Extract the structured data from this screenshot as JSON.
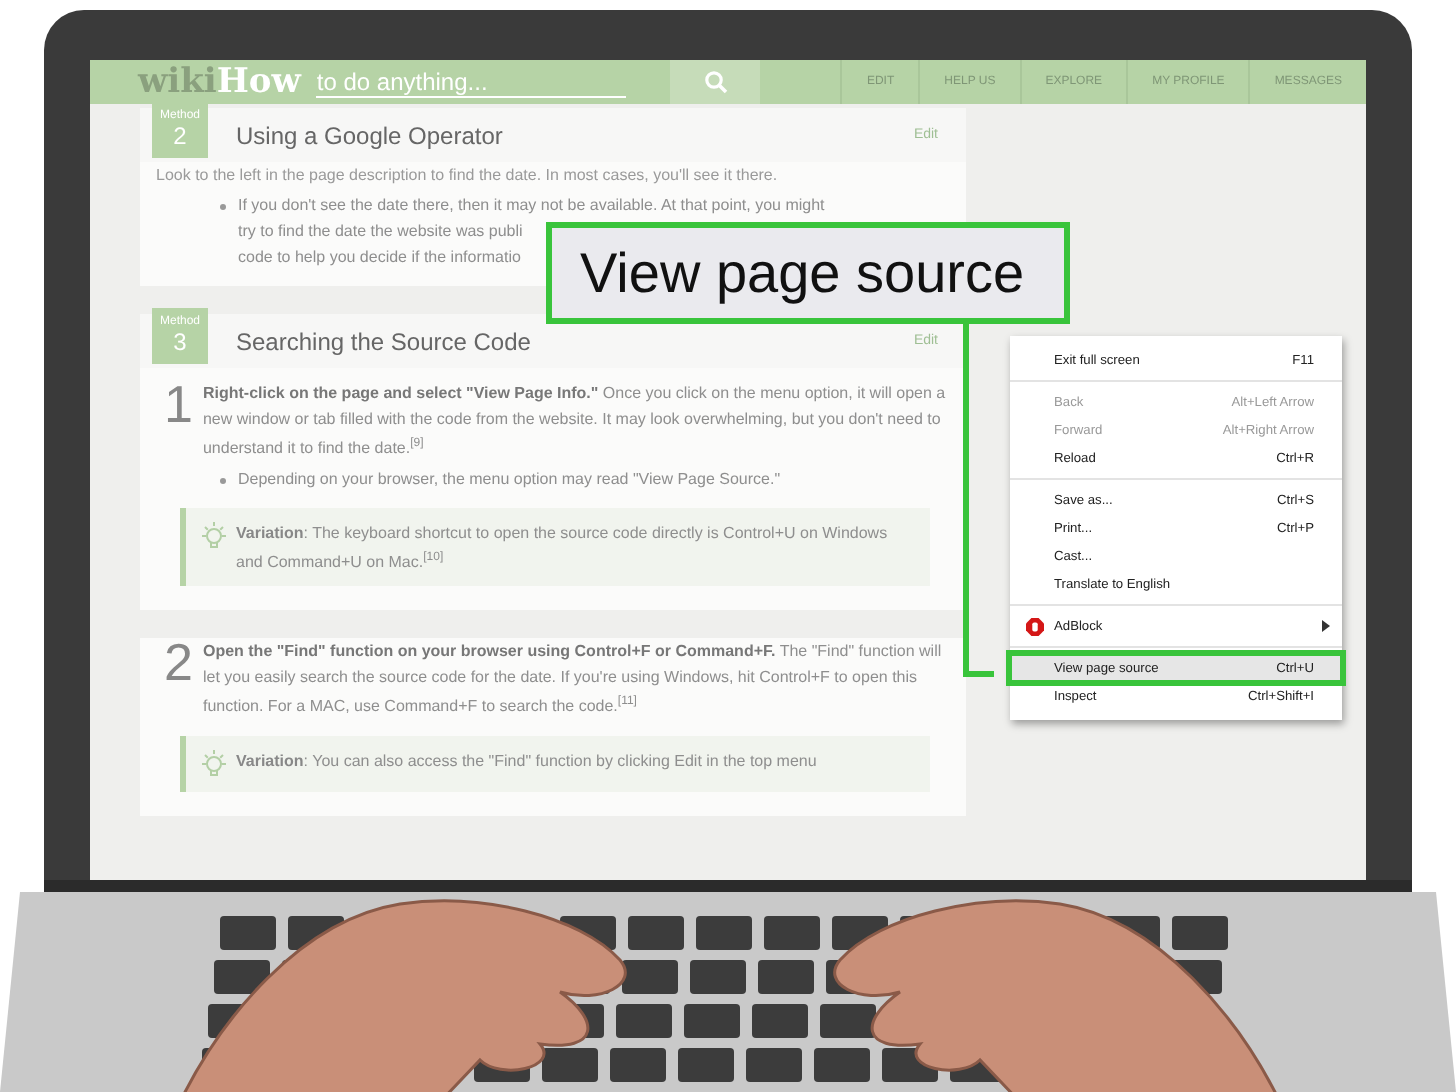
{
  "header": {
    "logo_wiki": "wiki",
    "logo_how": "How",
    "search_placeholder": "to do anything...",
    "nav": [
      "EDIT",
      "HELP US",
      "EXPLORE",
      "MY PROFILE",
      "MESSAGES"
    ]
  },
  "methods": [
    {
      "badge_label": "Method",
      "number": "2",
      "title": "Using a Google Operator",
      "edit": "Edit",
      "blocks": [
        {
          "kind": "text",
          "text": "Look to the left in the page description to find the date. In most cases, you'll see it there."
        },
        {
          "kind": "bullet",
          "lines": [
            "If you don't see the date there, then it may not be available. At that point, you might",
            "try to find the date the website was publi",
            "code to help you decide if the informatio"
          ]
        }
      ]
    },
    {
      "badge_label": "Method",
      "number": "3",
      "title": "Searching the Source Code",
      "edit": "Edit",
      "blocks": [
        {
          "kind": "step",
          "number": "1",
          "text": "**Right-click on the page and select \"View Page Info.\"** Once you click on the menu option, it will open a new window or tab filled with the code from the website. It may look overwhelming, but you don't need to understand it to find the date.$^{[9]}$"
        },
        {
          "kind": "bullet",
          "lines": [
            "Depending on your browser, the menu option may read \"View Page Source.\""
          ]
        },
        {
          "kind": "tip",
          "text": "**Variation**: The keyboard shortcut to open the source code directly is Control+U on Windows and Command+U on Mac.$^{[10]}$"
        }
      ]
    },
    {
      "blocks": [
        {
          "kind": "step",
          "number": "2",
          "text": "**Open the \"Find\" function on your browser using Control+F or Command+F.** The \"Find\" function will let you easily search the source code for the date. If you're using Windows, hit Control+F to open this function. For a MAC, use Command+F to search the code.$^{[11]}$"
        },
        {
          "kind": "tip",
          "text": "**Variation**: You can also access the \"Find\" function by clicking Edit in the top menu"
        }
      ]
    }
  ],
  "callout": {
    "text": "View page source"
  },
  "context_menu": [
    [
      {
        "kind": "plain",
        "label": "Exit full screen",
        "shortcut": "F11",
        "disabled": false,
        "selected": false
      }
    ],
    [
      {
        "kind": "plain",
        "label": "Back",
        "shortcut": "Alt+Left Arrow",
        "disabled": true,
        "selected": false
      },
      {
        "kind": "plain",
        "label": "Forward",
        "shortcut": "Alt+Right Arrow",
        "disabled": true,
        "selected": false
      },
      {
        "kind": "plain",
        "label": "Reload",
        "shortcut": "Ctrl+R",
        "disabled": false,
        "selected": false
      }
    ],
    [
      {
        "kind": "plain",
        "label": "Save as...",
        "shortcut": "Ctrl+S",
        "disabled": false,
        "selected": false
      },
      {
        "kind": "plain",
        "label": "Print...",
        "shortcut": "Ctrl+P",
        "disabled": false,
        "selected": false
      },
      {
        "kind": "plain",
        "label": "Cast...",
        "disabled": false,
        "selected": false
      },
      {
        "kind": "plain",
        "label": "Translate to English",
        "disabled": false,
        "selected": false
      }
    ],
    [
      {
        "kind": "submenu",
        "label": "AdBlock",
        "disabled": false,
        "selected": false
      }
    ],
    [
      {
        "kind": "plain",
        "label": "View page source",
        "shortcut": "Ctrl+U",
        "disabled": false,
        "selected": true
      },
      {
        "kind": "plain",
        "label": "Inspect",
        "shortcut": "Ctrl+Shift+I",
        "disabled": false,
        "selected": false
      }
    ]
  ]
}
